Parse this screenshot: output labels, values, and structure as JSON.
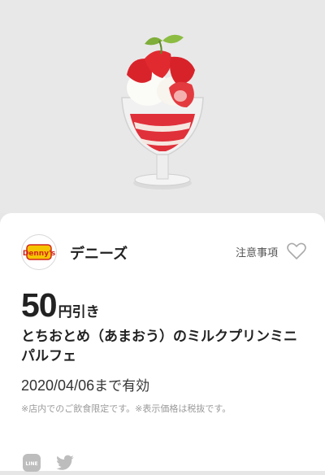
{
  "hero": {
    "image_name": "strawberry-parfait-image"
  },
  "brand": {
    "logo_text": "Denny's",
    "name": "デニーズ",
    "notes_link": "注意事項",
    "favorite_icon": "heart-icon"
  },
  "offer": {
    "amount": "50",
    "amount_unit": "円引き",
    "product_name": "とちおとめ（あまおう）のミルクプリンミニパルフェ",
    "valid_until_date": "2020/04/06",
    "valid_until_suffix": "まで有効",
    "footnote": "※店内でのご飲食限定です。※表示価格は税抜です。"
  },
  "share": {
    "line_label": "LINE",
    "line_icon": "line-icon",
    "twitter_icon": "twitter-icon"
  },
  "colors": {
    "brand_yellow": "#f5c400",
    "brand_red": "#d2261f",
    "text": "#222222",
    "muted": "#9a9a9a"
  }
}
